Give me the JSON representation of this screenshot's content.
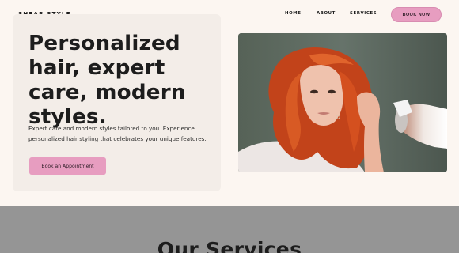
{
  "nav": {
    "logo": "SHEAR STYLE",
    "links": [
      "HOME",
      "ABOUT",
      "SERVICES"
    ],
    "cta": "BOOK NOW"
  },
  "hero": {
    "headline_lines": [
      "Personalized",
      "hair, expert",
      "care, modern",
      "styles."
    ],
    "subtext_lines": [
      "Expert care and modern styles tailored to you. Experience",
      "personalized hair styling that celebrates your unique features."
    ],
    "button": "Book an Appointment",
    "image_alt": "woman with red wavy hair using a hair dryer"
  },
  "services": {
    "title": "Our Services"
  },
  "colors": {
    "background": "#fcf6f1",
    "accent_pink": "#e79dc0",
    "card": "#f3ede8",
    "services_band": "#959595"
  }
}
